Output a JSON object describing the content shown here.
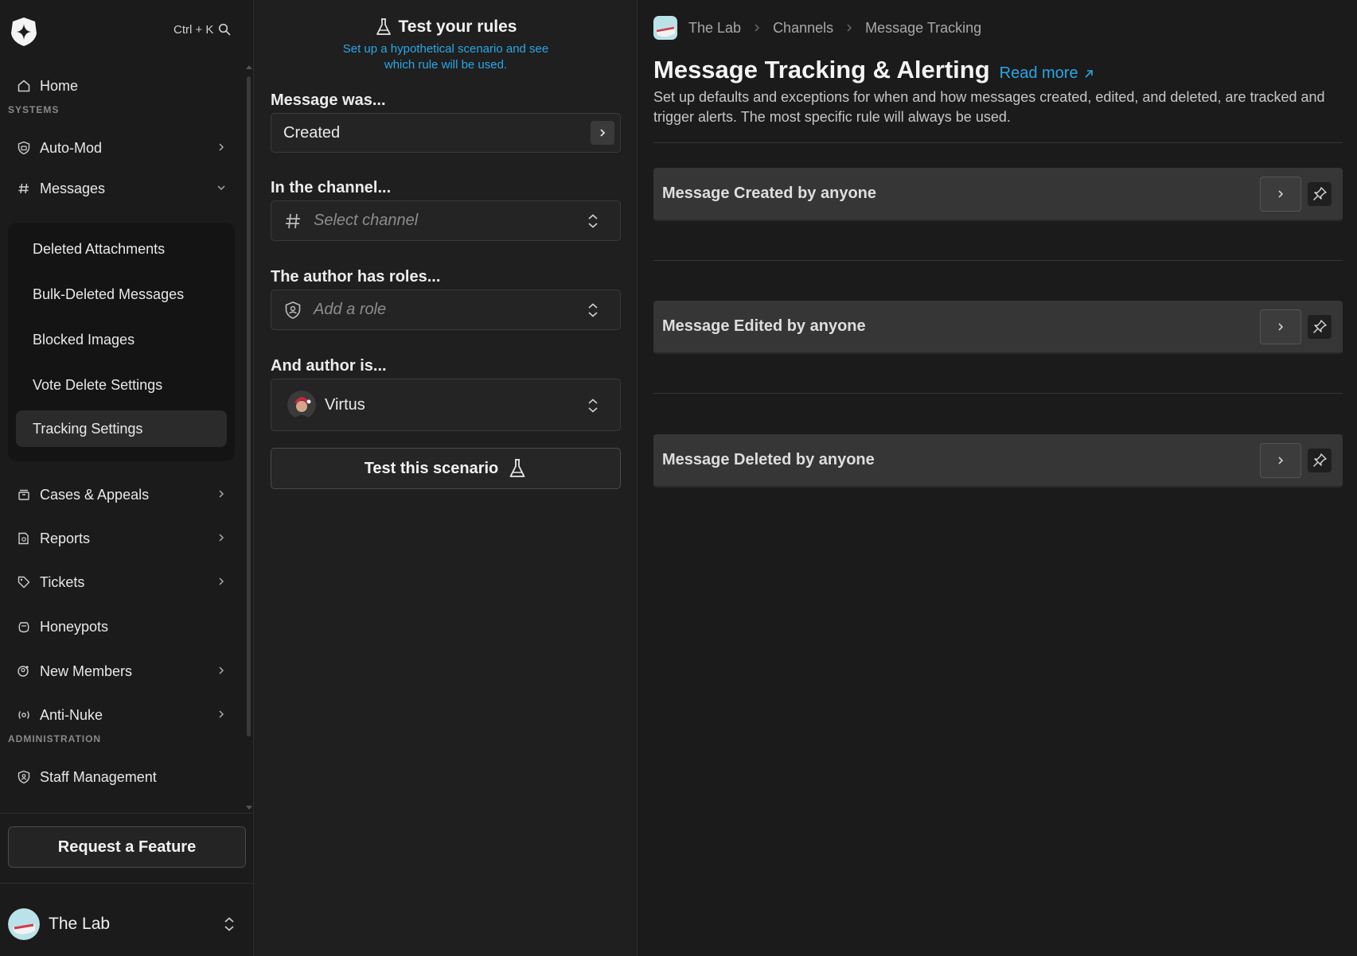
{
  "sidebar": {
    "search_shortcut": "Ctrl + K",
    "home": "Home",
    "section_systems": "SYSTEMS",
    "auto_mod": "Auto-Mod",
    "messages": "Messages",
    "messages_sub": [
      "Deleted Attachments",
      "Bulk-Deleted Messages",
      "Blocked Images",
      "Vote Delete Settings",
      "Tracking Settings"
    ],
    "cases_appeals": "Cases & Appeals",
    "reports": "Reports",
    "tickets": "Tickets",
    "honeypots": "Honeypots",
    "new_members": "New Members",
    "anti_nuke": "Anti-Nuke",
    "section_admin": "ADMINISTRATION",
    "staff_management": "Staff Management",
    "request_feature": "Request a Feature",
    "server_name": "The Lab"
  },
  "tester": {
    "title": "Test your rules",
    "subtitle": "Set up a hypothetical scenario and see which rule will be used.",
    "message_was_label": "Message was...",
    "message_was_value": "Created",
    "channel_label": "In the channel...",
    "channel_placeholder": "Select channel",
    "roles_label": "The author has roles...",
    "roles_placeholder": "Add a role",
    "author_label": "And author is...",
    "author_value": "Virtus",
    "test_button": "Test this scenario"
  },
  "main": {
    "breadcrumb": [
      "The Lab",
      "Channels",
      "Message Tracking"
    ],
    "title": "Message Tracking & Alerting",
    "read_more": "Read more",
    "description": "Set up defaults and exceptions for when and how messages created, edited, and deleted, are tracked and trigger alerts. The most specific rule will always be used.",
    "rules": [
      "Message Created by anyone",
      "Message Edited by anyone",
      "Message Deleted by anyone"
    ]
  },
  "colors": {
    "accent": "#2aa7e8",
    "background": "#1b1b1b",
    "panel": "#1f1f1f",
    "rule_bg": "#363636"
  }
}
